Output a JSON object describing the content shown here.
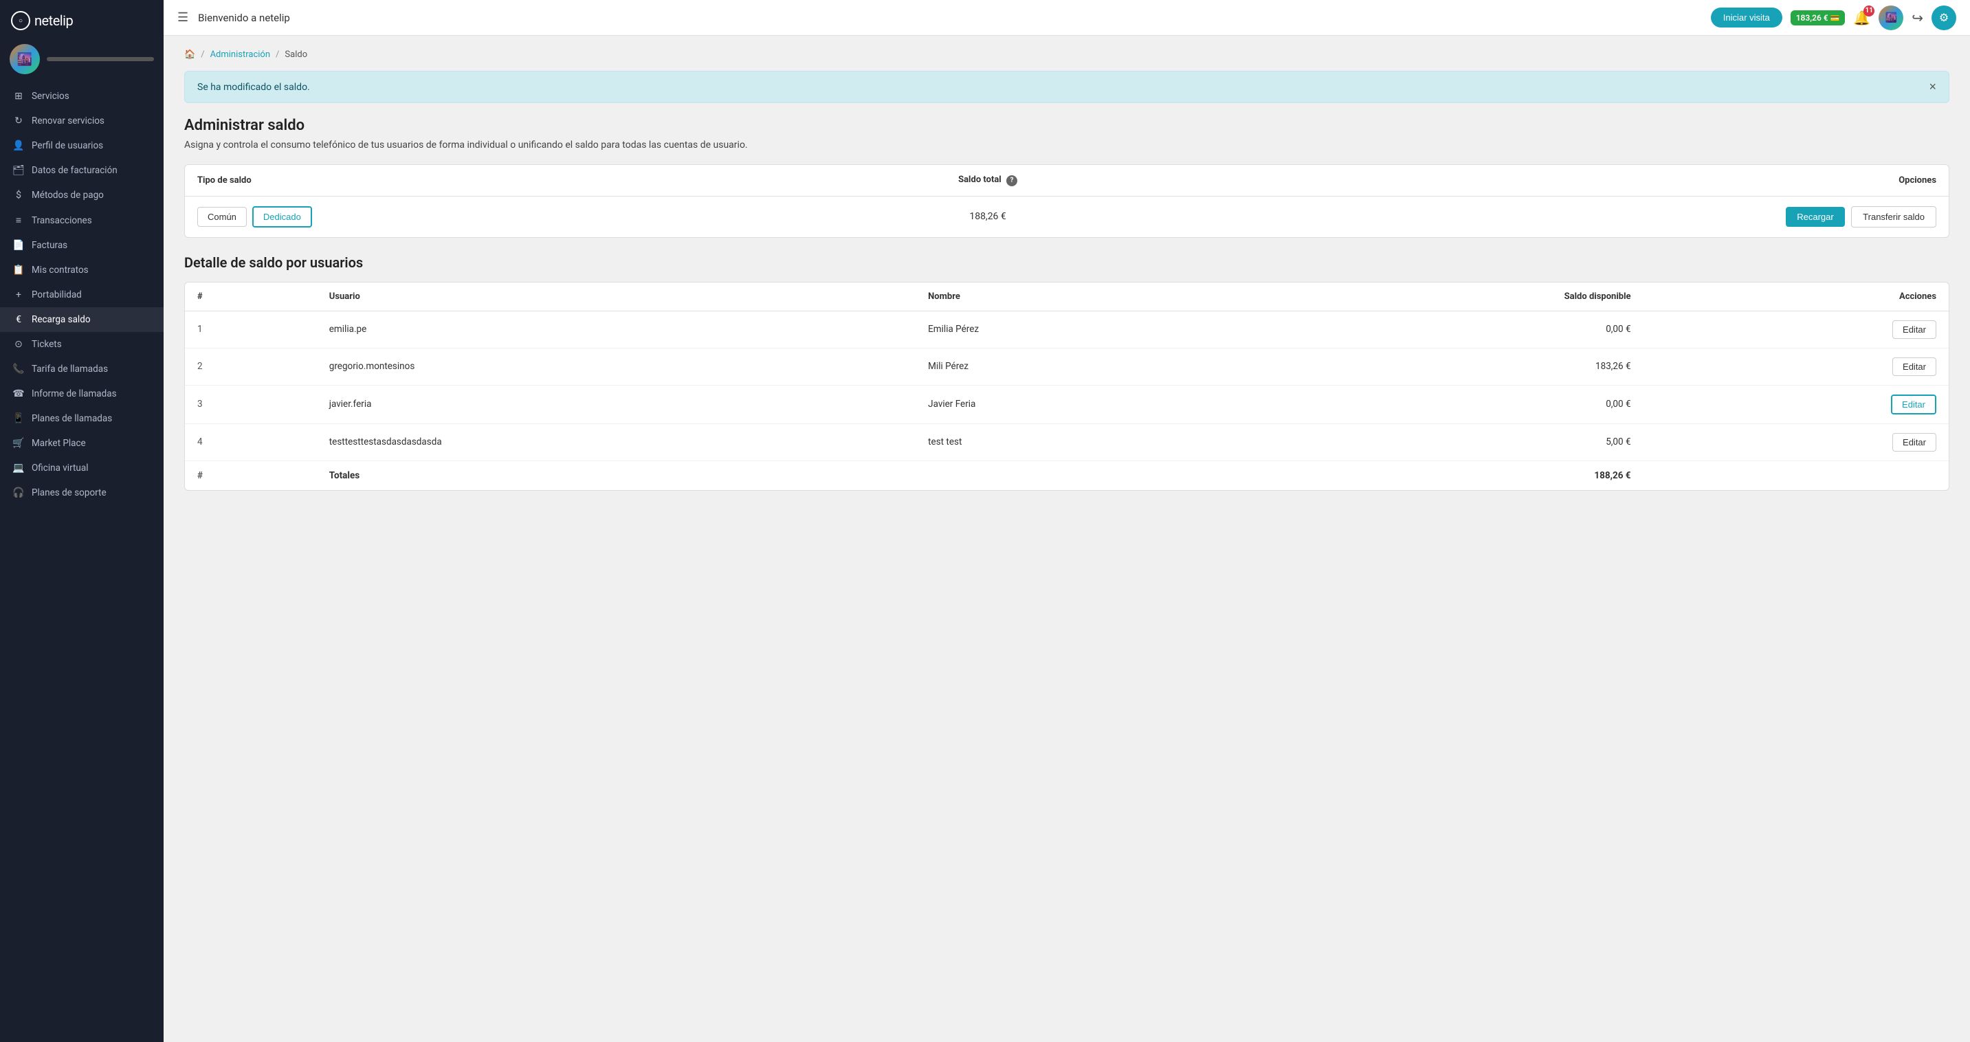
{
  "sidebar": {
    "logo_text": "netelip",
    "nav_items": [
      {
        "id": "servicios",
        "label": "Servicios",
        "icon": "⊞",
        "active": false
      },
      {
        "id": "renovar",
        "label": "Renovar servicios",
        "icon": "↻",
        "active": false
      },
      {
        "id": "perfil",
        "label": "Perfil de usuarios",
        "icon": "👤",
        "active": false
      },
      {
        "id": "facturacion",
        "label": "Datos de facturación",
        "icon": "🗂",
        "active": false
      },
      {
        "id": "metodos-pago",
        "label": "Métodos de pago",
        "icon": "$",
        "active": false
      },
      {
        "id": "transacciones",
        "label": "Transacciones",
        "icon": "≡",
        "active": false
      },
      {
        "id": "facturas",
        "label": "Facturas",
        "icon": "📄",
        "active": false
      },
      {
        "id": "contratos",
        "label": "Mis contratos",
        "icon": "📋",
        "active": false
      },
      {
        "id": "portabilidad",
        "label": "Portabilidad",
        "icon": "+",
        "active": false
      },
      {
        "id": "recarga",
        "label": "Recarga saldo",
        "icon": "€",
        "active": true
      },
      {
        "id": "tickets",
        "label": "Tickets",
        "icon": "⊙",
        "active": false
      },
      {
        "id": "tarifa",
        "label": "Tarifa de llamadas",
        "icon": "📞",
        "active": false
      },
      {
        "id": "informe",
        "label": "Informe de llamadas",
        "icon": "☎",
        "active": false
      },
      {
        "id": "planes-llamadas",
        "label": "Planes de llamadas",
        "icon": "📱",
        "active": false
      },
      {
        "id": "marketplace",
        "label": "Market Place",
        "icon": "🛒",
        "active": false
      },
      {
        "id": "oficina",
        "label": "Oficina virtual",
        "icon": "💻",
        "active": false
      },
      {
        "id": "soporte",
        "label": "Planes de soporte",
        "icon": "🎧",
        "active": false
      }
    ]
  },
  "topbar": {
    "menu_label": "☰",
    "title": "Bienvenido a netelip",
    "iniciar_visita": "Iniciar visita",
    "balance": "183,26 €",
    "notif_count": "11"
  },
  "breadcrumb": {
    "home_icon": "🏠",
    "sep1": "/",
    "admin_link": "Administración",
    "sep2": "/",
    "current": "Saldo"
  },
  "alert": {
    "message": "Se ha modificado el saldo.",
    "close_label": "×"
  },
  "page": {
    "title": "Administrar saldo",
    "description": "Asigna y controla el consumo telefónico de tus usuarios de forma individual o unificando el saldo para todas las cuentas de usuario."
  },
  "balance_table": {
    "col_tipo": "Tipo de saldo",
    "col_saldo": "Saldo total",
    "col_opciones": "Opciones",
    "tipo_comun": "Común",
    "tipo_dedicado": "Dedicado",
    "saldo_total": "188,26 €",
    "btn_recargar": "Recargar",
    "btn_transferir": "Transferir saldo"
  },
  "detail": {
    "title": "Detalle de saldo por usuarios",
    "col_num": "#",
    "col_usuario": "Usuario",
    "col_nombre": "Nombre",
    "col_saldo": "Saldo disponible",
    "col_acciones": "Acciones",
    "rows": [
      {
        "num": 1,
        "usuario": "emilia.pe",
        "nombre": "Emilia Pérez",
        "saldo": "0,00 €",
        "btn": "Editar",
        "highlighted": false
      },
      {
        "num": 2,
        "usuario": "gregorio.montesinos",
        "nombre": "Mili Pérez",
        "saldo": "183,26 €",
        "btn": "Editar",
        "highlighted": false
      },
      {
        "num": 3,
        "usuario": "javier.feria",
        "nombre": "Javier Feria",
        "saldo": "0,00 €",
        "btn": "Editar",
        "highlighted": true
      },
      {
        "num": 4,
        "usuario": "testtesttestasdasdasdasda",
        "nombre": "test test",
        "saldo": "5,00 €",
        "btn": "Editar",
        "highlighted": false
      }
    ],
    "footer_num": "#",
    "footer_label": "Totales",
    "footer_saldo": "188,26 €"
  }
}
